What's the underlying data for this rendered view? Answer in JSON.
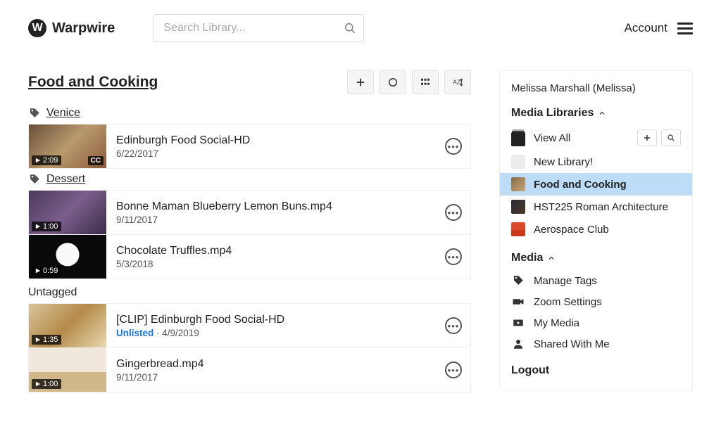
{
  "brand": "Warpwire",
  "search": {
    "placeholder": "Search Library..."
  },
  "account": {
    "label": "Account"
  },
  "library": {
    "title": "Food and Cooking",
    "groups": [
      {
        "tag": "Venice",
        "items": [
          {
            "title": "Edinburgh Food Social-HD",
            "date": "6/22/2017",
            "duration": "2:09",
            "cc": "CC",
            "thumb": "th-food1"
          }
        ]
      },
      {
        "tag": "Dessert",
        "items": [
          {
            "title": "Bonne Maman Blueberry Lemon Buns.mp4",
            "date": "9/11/2017",
            "duration": "1:00",
            "thumb": "th-blue"
          },
          {
            "title": "Chocolate Truffles.mp4",
            "date": "5/3/2018",
            "duration": "0:59",
            "thumb": "th-truffle"
          }
        ]
      }
    ],
    "untagged_label": "Untagged",
    "untagged_items": [
      {
        "title": "[CLIP] Edinburgh Food Social-HD",
        "unlisted": "Unlisted",
        "date_suffix": " · 4/9/2019",
        "duration": "1:35",
        "thumb": "th-clip"
      },
      {
        "title": "Gingerbread.mp4",
        "date": "9/11/2017",
        "duration": "1:00",
        "thumb": "th-ginger"
      }
    ]
  },
  "panel": {
    "user": "Melissa Marshall (Melissa)",
    "media_libraries_label": "Media Libraries",
    "view_all": "View All",
    "libs": [
      {
        "name": "New Library!",
        "thumb": "sq-empty"
      },
      {
        "name": "Food and Cooking",
        "thumb": "sq-food",
        "selected": true
      },
      {
        "name": "HST225 Roman Architecture",
        "thumb": "sq-arch"
      },
      {
        "name": "Aerospace Club",
        "thumb": "sq-aero"
      }
    ],
    "media_label": "Media",
    "media_items": [
      {
        "label": "Manage Tags",
        "icon": "tag"
      },
      {
        "label": "Zoom Settings",
        "icon": "camera"
      },
      {
        "label": "My Media",
        "icon": "play"
      },
      {
        "label": "Shared With Me",
        "icon": "person"
      }
    ],
    "logout": "Logout"
  }
}
